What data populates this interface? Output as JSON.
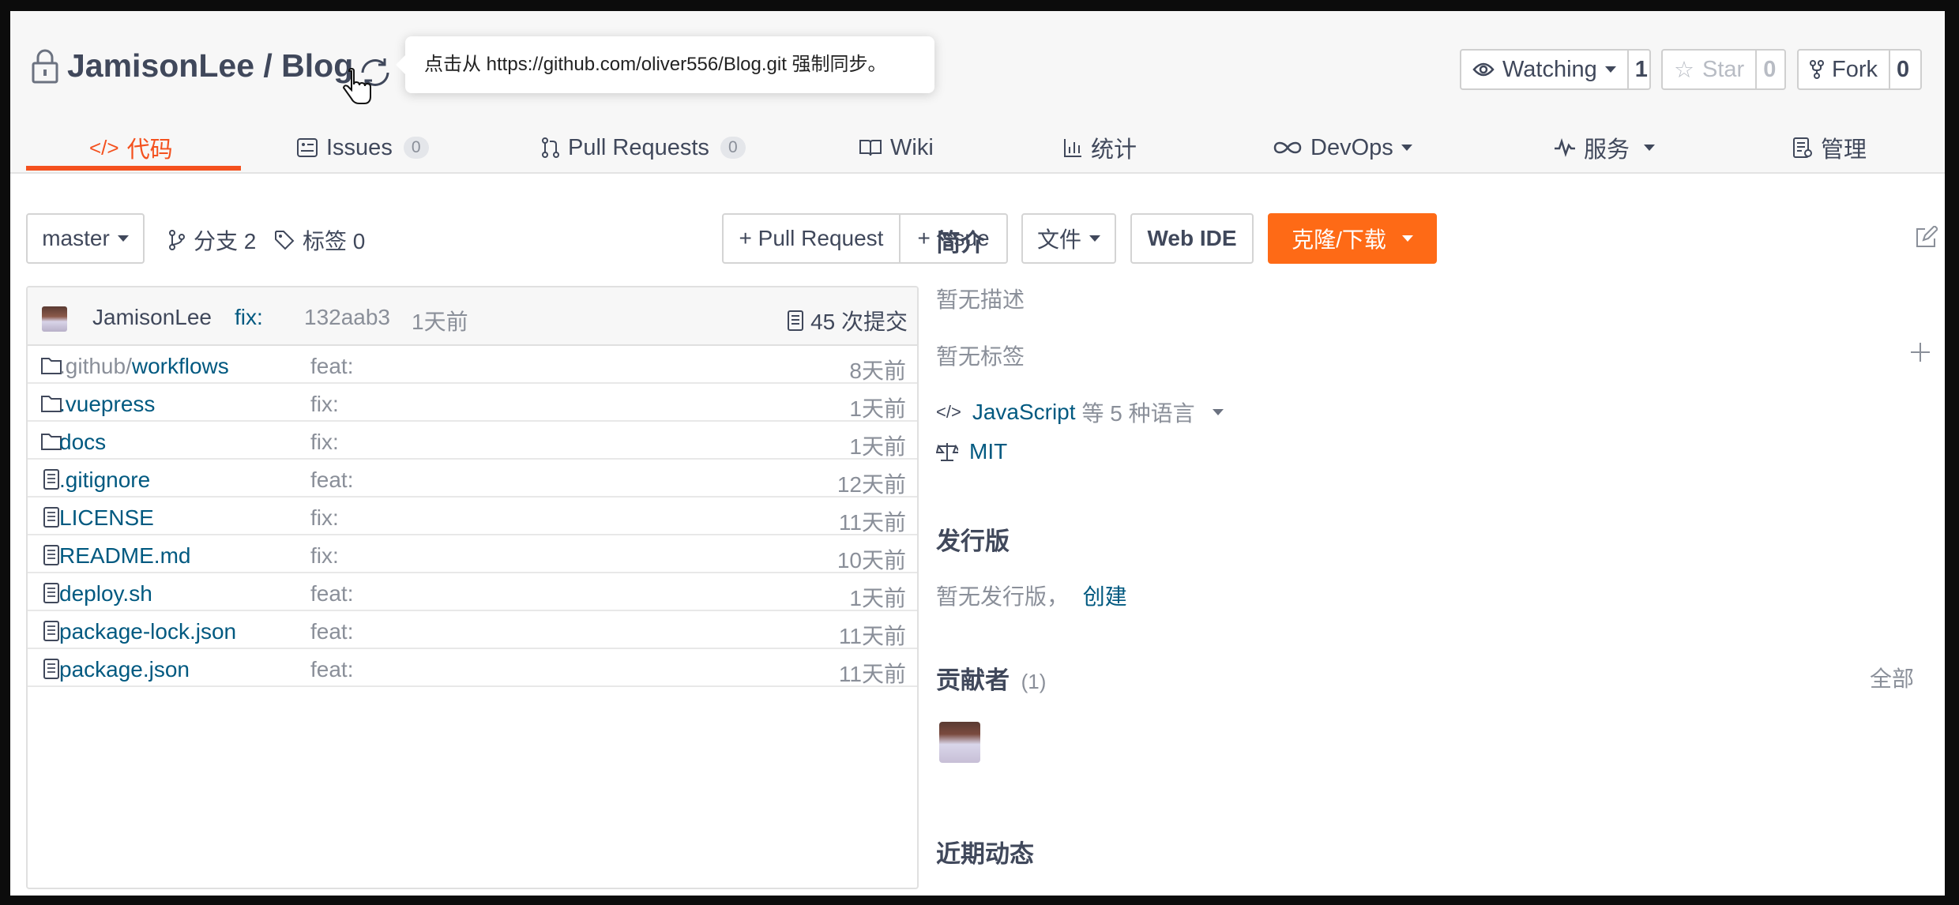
{
  "repo": {
    "owner": "JamisonLee",
    "separator": " / ",
    "name": "Blog",
    "title": "JamisonLee / Blog",
    "sync_tooltip": "点击从 https://github.com/oliver556/Blog.git 强制同步。"
  },
  "actions": {
    "watch": {
      "label": "Watching",
      "count": "1"
    },
    "star": {
      "label": "Star",
      "count": "0"
    },
    "fork": {
      "label": "Fork",
      "count": "0"
    }
  },
  "tabs": [
    {
      "label": "代码",
      "icon": "code-icon",
      "active": true
    },
    {
      "label": "Issues",
      "badge": "0",
      "icon": "issues-icon"
    },
    {
      "label": "Pull Requests",
      "badge": "0",
      "icon": "pull-request-icon"
    },
    {
      "label": "Wiki",
      "icon": "book-icon"
    },
    {
      "label": "统计",
      "icon": "bar-chart-icon"
    },
    {
      "label": "DevOps",
      "icon": "infinity-icon"
    },
    {
      "label": "服务",
      "icon": "pulse-icon"
    },
    {
      "label": "管理",
      "icon": "settings-doc-icon"
    }
  ],
  "toolbar": {
    "branch": "master",
    "branches": "分支 2",
    "tags": "标签 0",
    "pull_request": "+ Pull Request",
    "issue": "+ Issue",
    "files": "文件",
    "web_ide": "Web IDE",
    "clone": "克隆/下载"
  },
  "latest_commit": {
    "author": "JamisonLee",
    "message": "fix:",
    "hash": "132aab3",
    "time": "1天前",
    "commits": "45 次提交"
  },
  "files": [
    {
      "type": "folder",
      "prefix": ".github/",
      "name": "workflows",
      "message": "feat:",
      "time": "8天前"
    },
    {
      "type": "folder",
      "prefix": "",
      "name": ".vuepress",
      "message": "fix:",
      "time": "1天前"
    },
    {
      "type": "folder",
      "prefix": "",
      "name": "docs",
      "message": "fix:",
      "time": "1天前"
    },
    {
      "type": "file",
      "prefix": "",
      "name": ".gitignore",
      "message": "feat:",
      "time": "12天前"
    },
    {
      "type": "file",
      "prefix": "",
      "name": "LICENSE",
      "message": "fix:",
      "time": "11天前"
    },
    {
      "type": "file",
      "prefix": "",
      "name": "README.md",
      "message": "fix:",
      "time": "10天前"
    },
    {
      "type": "file",
      "prefix": "",
      "name": "deploy.sh",
      "message": "feat:",
      "time": "1天前"
    },
    {
      "type": "file",
      "prefix": "",
      "name": "package-lock.json",
      "message": "feat:",
      "time": "11天前"
    },
    {
      "type": "file",
      "prefix": "",
      "name": "package.json",
      "message": "feat:",
      "time": "11天前"
    }
  ],
  "sidebar": {
    "intro_title": "简介",
    "no_description": "暂无描述",
    "no_tags": "暂无标签",
    "language": "JavaScript",
    "language_suffix": "等 5 种语言",
    "license": "MIT",
    "releases_title": "发行版",
    "no_releases": "暂无发行版，",
    "create_link": "创建",
    "contributors_title": "贡献者",
    "contributors_count": "(1)",
    "all_link": "全部",
    "activity_title": "近期动态"
  },
  "colors": {
    "accent": "#f4511e",
    "clone_button": "#fe6a16",
    "link": "#005980",
    "text": "#40485b",
    "muted": "#8a8f99"
  }
}
